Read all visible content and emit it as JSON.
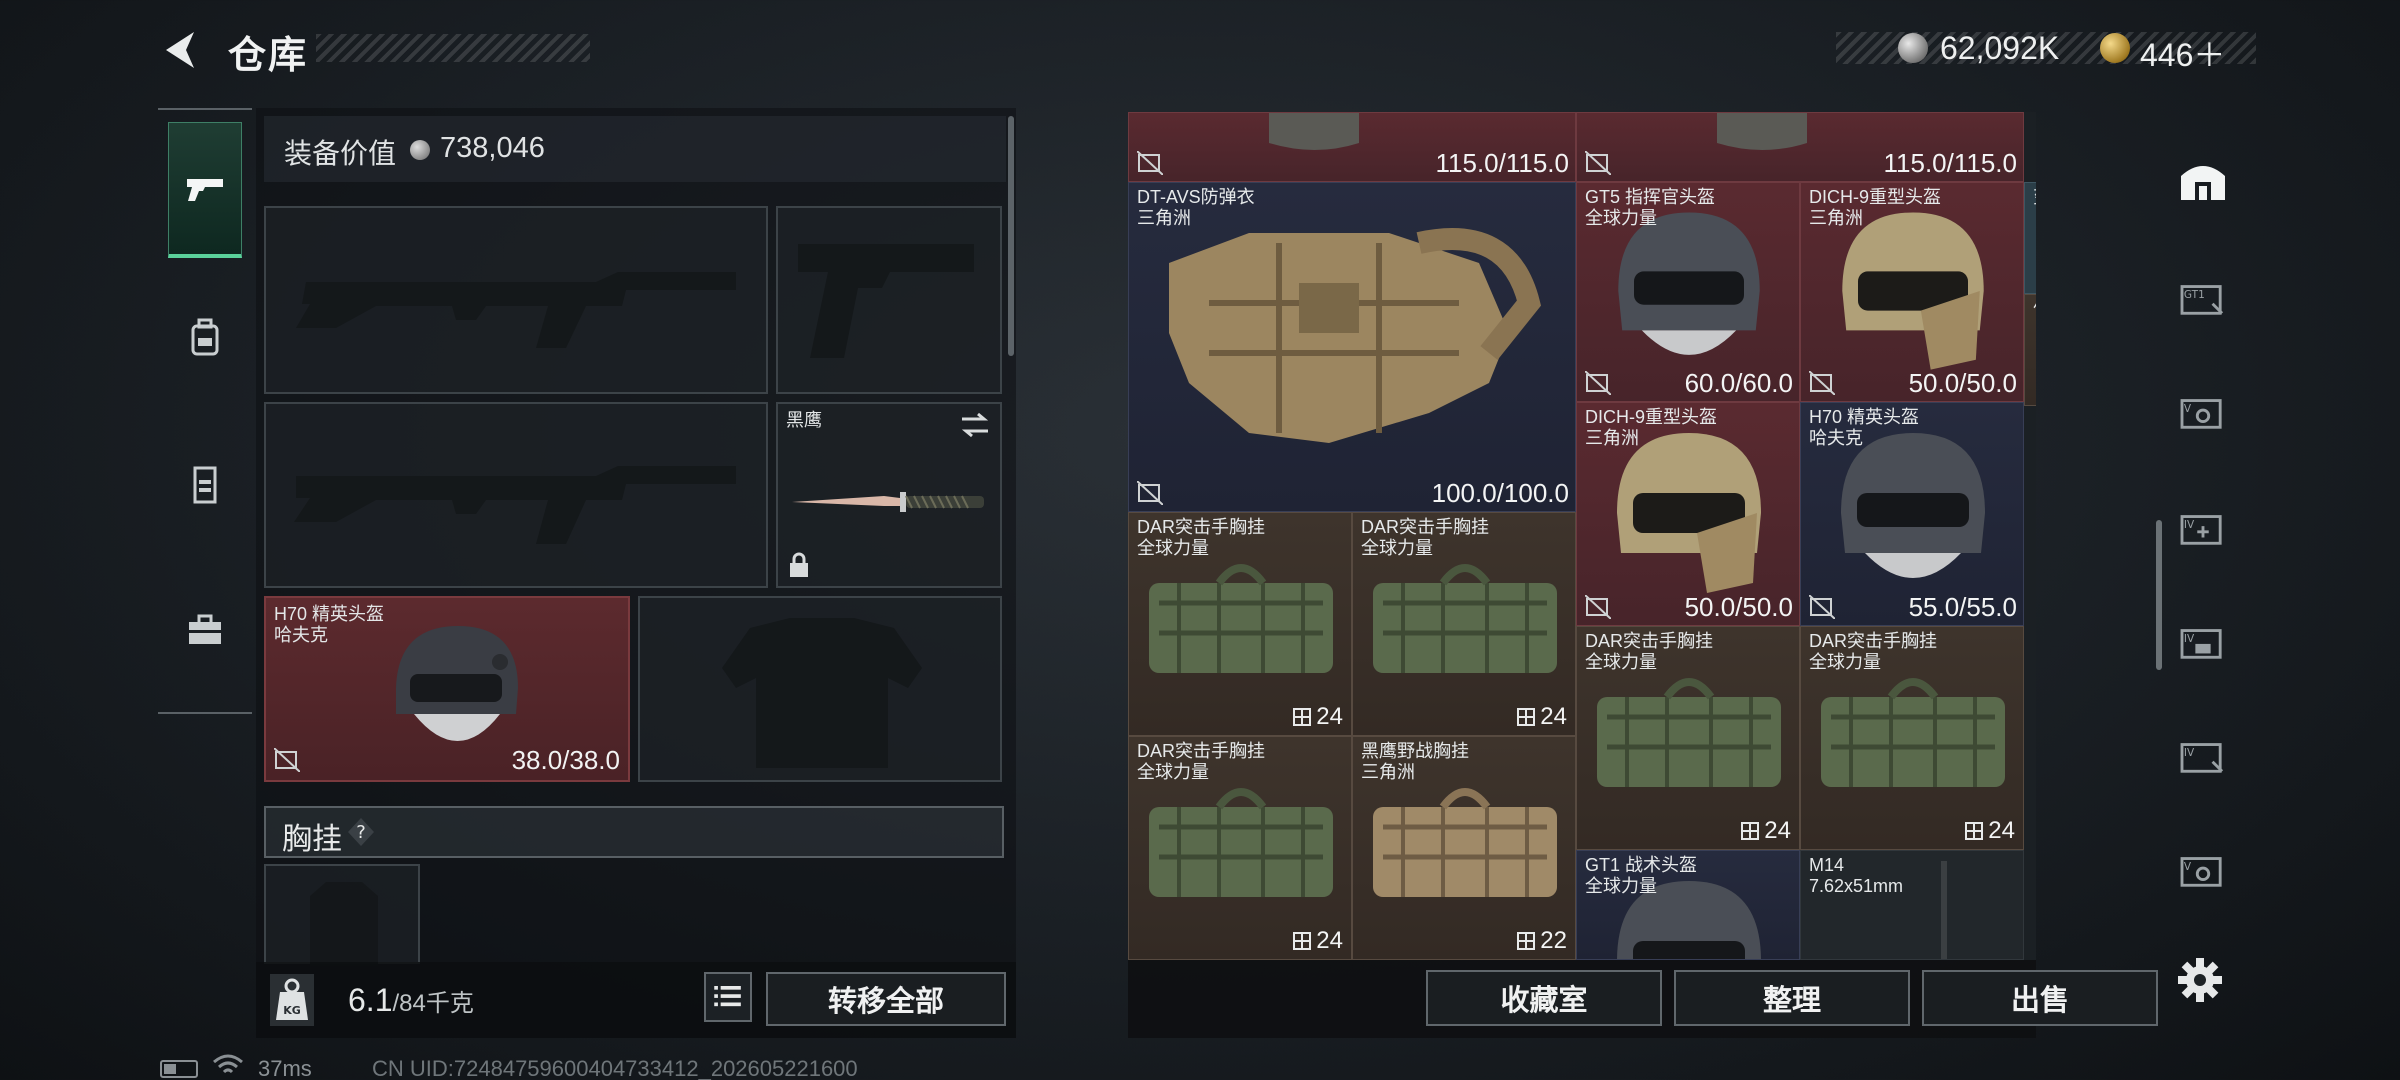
{
  "header": {
    "title": "仓库",
    "currency1": "62,092K",
    "currency2": "446＋"
  },
  "left_tabs": [
    {
      "icon": "pistol-icon",
      "active": true
    },
    {
      "icon": "backpack-icon",
      "active": false
    },
    {
      "icon": "vest-icon",
      "active": false
    },
    {
      "icon": "toolbox-icon",
      "active": false
    }
  ],
  "loadout": {
    "value_label": "装备价值",
    "value": "738,046",
    "knife_label": "黑鹰",
    "helmet": {
      "name": "H70 精英头盔\n哈夫克",
      "durability": "38.0/38.0"
    },
    "section_label": "胸挂",
    "section_help": "?",
    "weight": "6.1",
    "weight_max": "/84千克",
    "transfer_label": "转移全部"
  },
  "stash": {
    "items": [
      {
        "name": "",
        "durability": "115.0/115.0",
        "count": ""
      },
      {
        "name": "",
        "durability": "115.0/115.0",
        "count": ""
      },
      {
        "name": "DT-AVS防弹衣\n三角洲",
        "durability": "100.0/100.0",
        "count": ""
      },
      {
        "name": "GT5 指挥官头盔\n全球力量",
        "durability": "60.0/60.0",
        "count": ""
      },
      {
        "name": "DICH-9重型头盔\n三角洲",
        "durability": "50.0/50.0",
        "count": ""
      },
      {
        "name": "变电站宿舍",
        "durability": "",
        "count": ""
      },
      {
        "name": "信物",
        "durability": "",
        "count": ""
      },
      {
        "name": "DICH-9重型头盔\n三角洲",
        "durability": "50.0/50.0",
        "count": ""
      },
      {
        "name": "H70 精英头盔\n哈夫克",
        "durability": "55.0/55.0",
        "count": ""
      },
      {
        "name": "DAR突击手胸挂\n全球力量",
        "durability": "",
        "count": "24"
      },
      {
        "name": "DAR突击手胸挂\n全球力量",
        "durability": "",
        "count": "24"
      },
      {
        "name": "DAR突击手胸挂\n全球力量",
        "durability": "",
        "count": "24"
      },
      {
        "name": "DAR突击手胸挂\n全球力量",
        "durability": "",
        "count": "24"
      },
      {
        "name": "DAR突击手胸挂\n全球力量",
        "durability": "",
        "count": "24"
      },
      {
        "name": "黑鹰野战胸挂\n三角洲",
        "durability": "",
        "count": "22"
      },
      {
        "name": "GT1 战术头盔\n全球力量",
        "durability": "",
        "count": ""
      },
      {
        "name": "M14\n7.62x51mm",
        "durability": "",
        "count": ""
      }
    ],
    "buttons": {
      "collection": "收藏室",
      "organize": "整理",
      "sell": "出售"
    }
  },
  "status": {
    "ping": "37ms",
    "uid": "CN UID:72484759600404733412_202605221600"
  }
}
